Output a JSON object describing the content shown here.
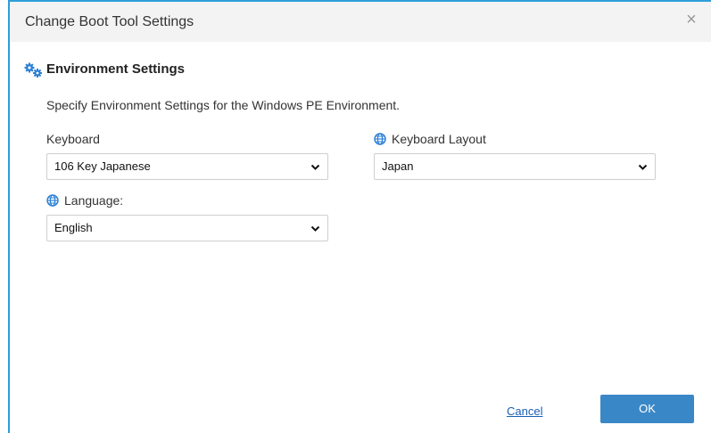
{
  "dialog": {
    "title": "Change Boot Tool Settings",
    "close_label": "×"
  },
  "section": {
    "title": "Environment Settings",
    "description": "Specify Environment Settings for the Windows PE Environment."
  },
  "fields": {
    "keyboard": {
      "label": "Keyboard",
      "value": "106 Key Japanese"
    },
    "keyboard_layout": {
      "label": "Keyboard Layout",
      "value": "Japan"
    },
    "language": {
      "label": "Language:",
      "value": "English"
    }
  },
  "footer": {
    "cancel_label": "Cancel",
    "ok_label": "OK"
  },
  "colors": {
    "accent": "#2b9fd9",
    "primary_button": "#3a87c8",
    "link": "#1a5fb4",
    "icon_blue": "#2a7fd4"
  },
  "icons": [
    "gears-icon",
    "globe-icon",
    "chevron-down-icon",
    "close-icon"
  ]
}
